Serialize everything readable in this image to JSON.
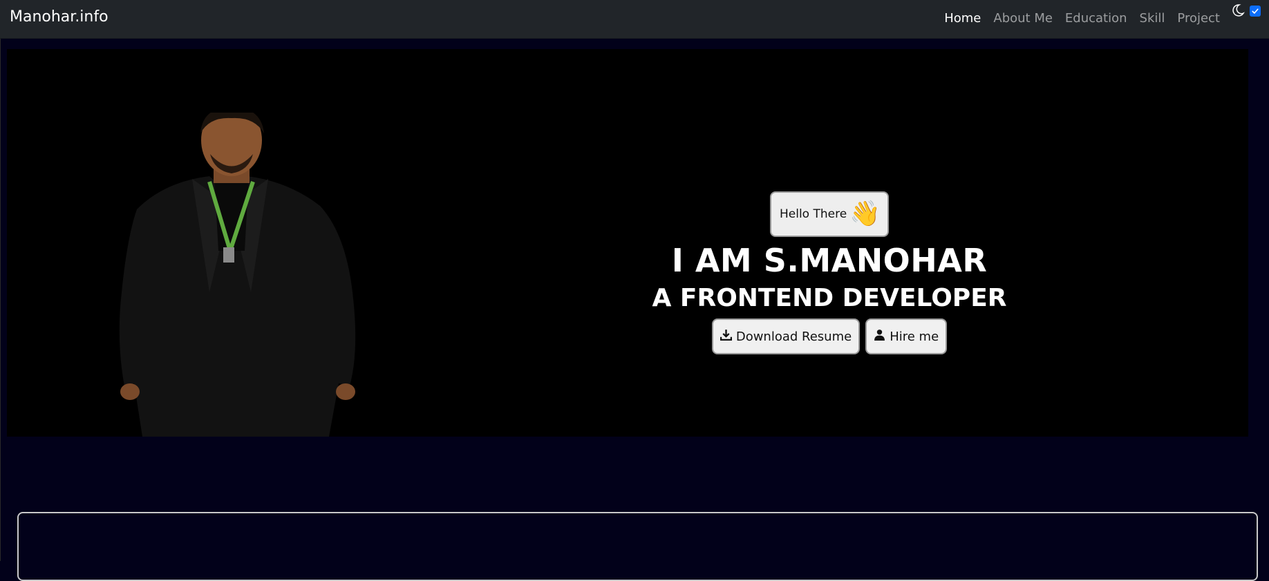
{
  "navbar": {
    "brand": "Manohar.info",
    "links": [
      {
        "label": "Home",
        "active": true
      },
      {
        "label": "About Me",
        "active": false
      },
      {
        "label": "Education",
        "active": false
      },
      {
        "label": "Skill",
        "active": false
      },
      {
        "label": "Project",
        "active": false
      }
    ],
    "theme_icon": "moon-icon",
    "theme_toggle_checked": true
  },
  "hero": {
    "greeting": "Hello There",
    "greeting_icon": "waving-hand-emoji",
    "wave_glyph": "👋",
    "title": "I AM S.MANOHAR",
    "subtitle": "A FRONTEND DEVELOPER",
    "download_label": "Download Resume",
    "download_icon": "download-icon",
    "hire_label": "Hire me",
    "hire_icon": "user-icon"
  },
  "colors": {
    "page_bg": "#02011a",
    "navbar_bg": "#212529",
    "hero_bg": "#000000",
    "accent": "#0d6efd"
  }
}
